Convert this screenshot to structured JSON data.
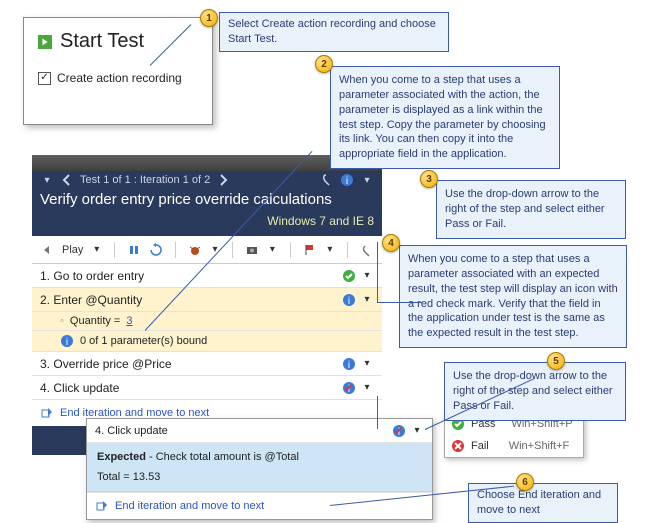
{
  "start_card": {
    "title": "Start Test",
    "checkbox_label": "Create action recording",
    "checkbox_checked": true
  },
  "runner": {
    "winbar": "▭  ×",
    "nav": {
      "counter": "Test 1 of 1 : Iteration 1 of 2",
      "chev": "▾"
    },
    "title": "Verify order entry price override calculations",
    "env": "Windows 7 and IE 8",
    "toolbar": {
      "play_label": "Play",
      "chev": "▾"
    },
    "steps": [
      {
        "n": "1.",
        "text": "Go to order entry",
        "status": "pass"
      },
      {
        "n": "2.",
        "text": "Enter @Quantity",
        "status": "info",
        "selected": true,
        "sub": {
          "param_label": "Quantity =",
          "param_value": "3",
          "bound_text": "0 of 1 parameter(s) bound"
        }
      },
      {
        "n": "3.",
        "text": "Override price @Price",
        "status": "info"
      },
      {
        "n": "4.",
        "text": "Click update",
        "status": "info-red"
      }
    ],
    "end_link": "End iteration and move to next"
  },
  "detail": {
    "step_n": "4.",
    "step_text": "Click update",
    "status": "info-red",
    "expected_label": "Expected",
    "expected_text": " - Check total amount is @Total",
    "total_label": "Total = ",
    "total_value": "13.53",
    "end_link": "End iteration and move to next"
  },
  "passfail": {
    "pass_label": "Pass",
    "pass_key": "Win+Shift+P",
    "fail_label": "Fail",
    "fail_key": "Win+Shift+F"
  },
  "callouts": {
    "c1": "Select Create action recording and choose Start Test.",
    "c2": "When you come to a step that uses a parameter associated with the action, the parameter is displayed as a link within the test step. Copy the parameter by choosing its link. You can then copy it into the appropriate field in the application.",
    "c3": "Use the drop-down arrow to the right of the step and select either Pass or Fail.",
    "c4": "When you come to a step that uses a parameter associated with an expected result, the test step will display an icon with a red check mark. Verify that the field in the application under test is the same as the expected result in the test step.",
    "c5": "Use the drop-down arrow to the right of the step and select either Pass or Fail.",
    "c6": "Choose End iteration and move to next"
  }
}
